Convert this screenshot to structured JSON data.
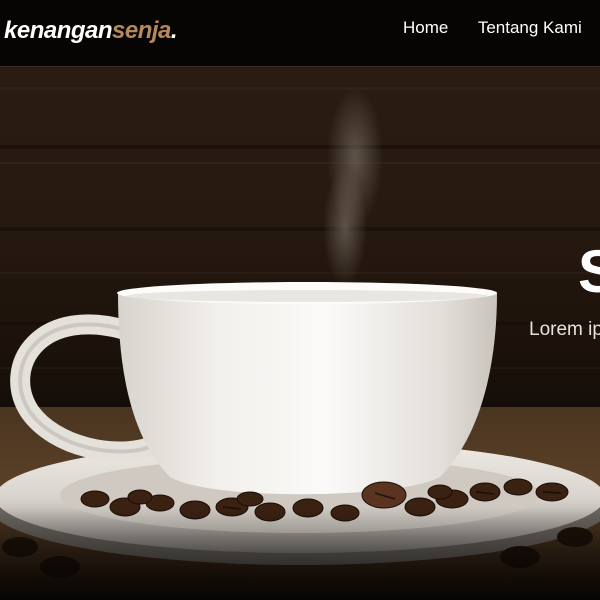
{
  "brand": {
    "name_part1": "kenangan",
    "name_part2": "senja",
    "name_suffix": ".",
    "accent_color": "#b6895b"
  },
  "nav": {
    "items": [
      {
        "label": "Home"
      },
      {
        "label": "Tentang Kami"
      }
    ]
  },
  "hero": {
    "title": "S",
    "text": "Lorem ip",
    "image": "coffee-cup-on-saucer-with-beans"
  }
}
